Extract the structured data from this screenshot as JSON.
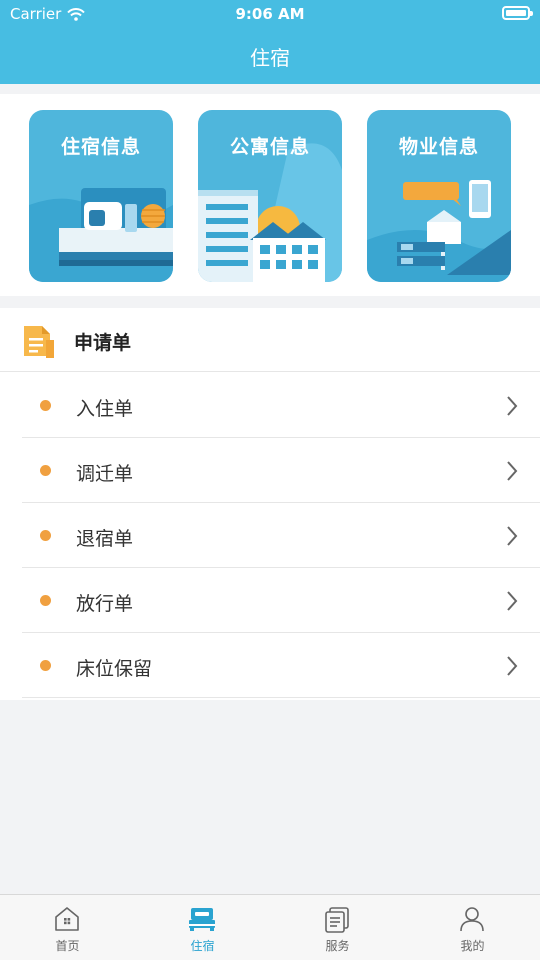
{
  "status_bar": {
    "carrier": "Carrier",
    "time": "9:06 AM"
  },
  "nav": {
    "title": "住宿"
  },
  "cards": [
    {
      "title": "住宿信息",
      "icon": "bed-illustration"
    },
    {
      "title": "公寓信息",
      "icon": "apartment-illustration"
    },
    {
      "title": "物业信息",
      "icon": "property-illustration"
    }
  ],
  "applications": {
    "title": "申请单",
    "items": [
      {
        "label": "入住单"
      },
      {
        "label": "调迁单"
      },
      {
        "label": "退宿单"
      },
      {
        "label": "放行单"
      },
      {
        "label": "床位保留"
      }
    ]
  },
  "tabbar": {
    "items": [
      {
        "label": "首页",
        "icon": "home-icon"
      },
      {
        "label": "住宿",
        "icon": "bed-icon"
      },
      {
        "label": "服务",
        "icon": "documents-icon"
      },
      {
        "label": "我的",
        "icon": "person-icon"
      }
    ],
    "active_index": 1
  },
  "colors": {
    "header": "#47bde2",
    "accent": "#2aa3d0",
    "dot": "#f0a040",
    "card": "#4fb6dc"
  }
}
